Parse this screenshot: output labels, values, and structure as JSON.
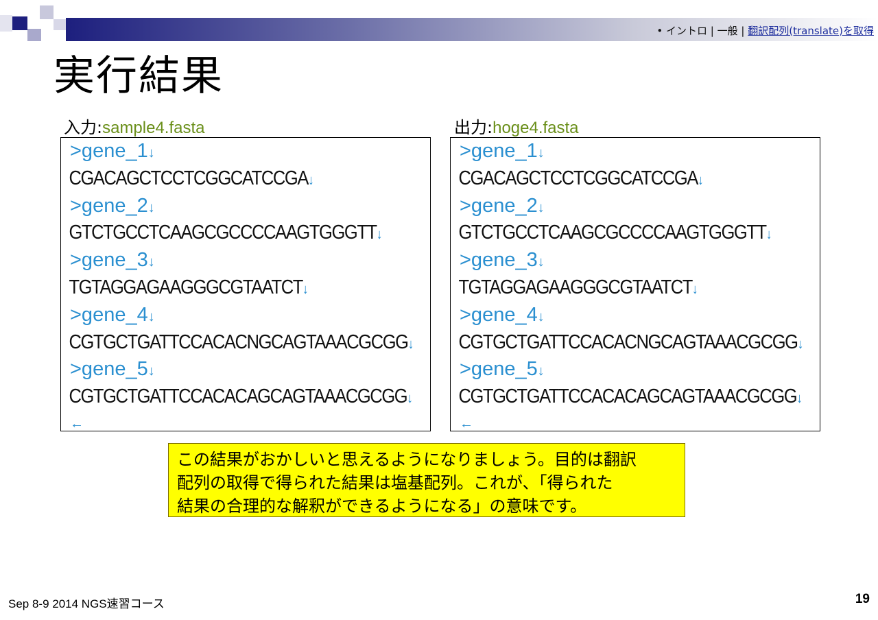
{
  "header": {
    "breadcrumb": {
      "bullet": "•",
      "items": [
        "イントロ",
        "一般"
      ],
      "separator": "|",
      "link": "翻訳配列(translate)を取得"
    },
    "title": "実行結果"
  },
  "input": {
    "label": "入力",
    "colon": ":",
    "filename": "sample4.fasta",
    "lines": [
      {
        "text": ">gene_1",
        "type": "header"
      },
      {
        "text": "CGACAGCTCCTCGGCATCCGA",
        "type": "sequence"
      },
      {
        "text": ">gene_2",
        "type": "header"
      },
      {
        "text": "GTCTGCCTCAAGCGCCCCAAGTGGGTT",
        "type": "sequence"
      },
      {
        "text": ">gene_3",
        "type": "header"
      },
      {
        "text": "TGTAGGAGAAGGGCGTAATCT",
        "type": "sequence"
      },
      {
        "text": ">gene_4",
        "type": "header"
      },
      {
        "text": "CGTGCTGATTCCACACNGCAGTAAACGCGG",
        "type": "sequence"
      },
      {
        "text": ">gene_5",
        "type": "header"
      },
      {
        "text": "CGTGCTGATTCCACACAGCAGTAAACGCGG",
        "type": "sequence"
      }
    ],
    "eof_mark": "←"
  },
  "output": {
    "label": "出力",
    "colon": ":",
    "filename": "hoge4.fasta",
    "lines": [
      {
        "text": ">gene_1",
        "type": "header"
      },
      {
        "text": "CGACAGCTCCTCGGCATCCGA",
        "type": "sequence"
      },
      {
        "text": ">gene_2",
        "type": "header"
      },
      {
        "text": "GTCTGCCTCAAGCGCCCCAAGTGGGTT",
        "type": "sequence"
      },
      {
        "text": ">gene_3",
        "type": "header"
      },
      {
        "text": "TGTAGGAGAAGGGCGTAATCT",
        "type": "sequence"
      },
      {
        "text": ">gene_4",
        "type": "header"
      },
      {
        "text": "CGTGCTGATTCCACACNGCAGTAAACGCGG",
        "type": "sequence"
      },
      {
        "text": ">gene_5",
        "type": "header"
      },
      {
        "text": "CGTGCTGATTCCACACAGCAGTAAACGCGG",
        "type": "sequence"
      }
    ],
    "eof_mark": "←"
  },
  "line_end_mark": "↓",
  "note": {
    "lines": [
      "この結果がおかしいと思えるようになりましょう。目的は翻訳",
      "配列の取得で得られた結果は塩基配列。これが、「得られた",
      "結果の合理的な解釈ができるようになる」の意味です。"
    ]
  },
  "footer": {
    "text": "Sep 8-9 2014 NGS速習コース",
    "page_number": "19"
  },
  "colors": {
    "accent_navy": "#1d1f7e",
    "filename_green": "#6a8f1a",
    "fasta_header_blue": "#2a8fd0",
    "note_background": "#ffff00",
    "link_blue": "#1f2f9e"
  }
}
